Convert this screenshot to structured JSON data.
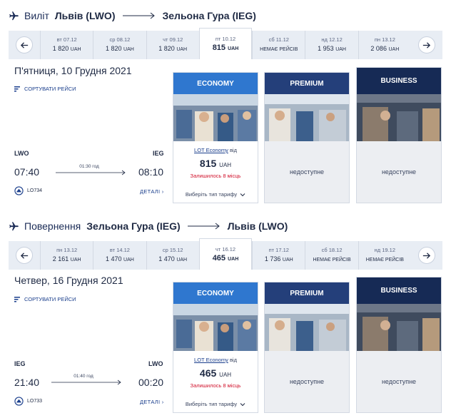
{
  "outbound": {
    "label": "Виліт",
    "from": "Львів (LWO)",
    "to": "Зельона Гура (IEG)",
    "dates": [
      {
        "day": "вт 07.12",
        "price": "1 820",
        "cur": "UAH"
      },
      {
        "day": "ср 08.12",
        "price": "1 820",
        "cur": "UAH"
      },
      {
        "day": "чт 09.12",
        "price": "1 820",
        "cur": "UAH"
      },
      {
        "day": "пт 10.12",
        "price": "815",
        "cur": "UAH"
      },
      {
        "day": "сб 11.12",
        "price": "НЕМАЄ РЕЙСІВ",
        "cur": ""
      },
      {
        "day": "нд 12.12",
        "price": "1 953",
        "cur": "UAH"
      },
      {
        "day": "пн 13.12",
        "price": "2 086",
        "cur": "UAH"
      }
    ],
    "selected_index": 3,
    "day_title": "П'ятниця, 10 Грудня 2021",
    "sort_label": "СОРТУВАТИ РЕЙСИ",
    "dep_code": "LWO",
    "arr_code": "IEG",
    "dep_time": "07:40",
    "arr_time": "08:10",
    "duration": "01:30 год",
    "flight_no": "LO734",
    "details": "ДЕТАЛІ",
    "economy": {
      "title": "ECONOMY",
      "fare_name": "LOT Economy",
      "fare_from": "від",
      "price": "815",
      "cur": "UAH",
      "seats": "Залишилось 8 місць",
      "choose": "Виберіть тип тарифу"
    },
    "premium": {
      "title": "PREMIUM",
      "status": "недоступне"
    },
    "business": {
      "title": "BUSINESS",
      "status": "недоступне"
    }
  },
  "return": {
    "label": "Повернення",
    "from": "Зельона Гура (IEG)",
    "to": "Львів (LWO)",
    "dates": [
      {
        "day": "пн 13.12",
        "price": "2 161",
        "cur": "UAH"
      },
      {
        "day": "вт 14.12",
        "price": "1 470",
        "cur": "UAH"
      },
      {
        "day": "ср 15.12",
        "price": "1 470",
        "cur": "UAH"
      },
      {
        "day": "чт 16.12",
        "price": "465",
        "cur": "UAH"
      },
      {
        "day": "пт 17.12",
        "price": "1 736",
        "cur": "UAH"
      },
      {
        "day": "сб 18.12",
        "price": "НЕМАЄ РЕЙСІВ",
        "cur": ""
      },
      {
        "day": "нд 19.12",
        "price": "НЕМАЄ РЕЙСІВ",
        "cur": ""
      }
    ],
    "selected_index": 3,
    "day_title": "Четвер, 16 Грудня 2021",
    "sort_label": "СОРТУВАТИ РЕЙСИ",
    "dep_code": "IEG",
    "arr_code": "LWO",
    "dep_time": "21:40",
    "arr_time": "00:20",
    "duration": "01:40 год",
    "flight_no": "LO733",
    "details": "ДЕТАЛІ",
    "economy": {
      "title": "ECONOMY",
      "fare_name": "LOT Economy",
      "fare_from": "від",
      "price": "465",
      "cur": "UAH",
      "seats": "Залишилось 8 місць",
      "choose": "Виберіть тип тарифу"
    },
    "premium": {
      "title": "PREMIUM",
      "status": "недоступне"
    },
    "business": {
      "title": "BUSINESS",
      "status": "недоступне"
    }
  },
  "colors": {
    "brand": "#1a2b56",
    "economy_head": "#2f77cf",
    "premium_head": "#243f7a",
    "business_head": "#162a55",
    "seats": "#d0102a"
  },
  "icons": [
    "plane-icon",
    "long-arrow-icon",
    "arrow-left-icon",
    "arrow-right-icon",
    "sort-icon",
    "lot-logo-icon",
    "chevron-right-icon",
    "chevron-down-icon"
  ]
}
